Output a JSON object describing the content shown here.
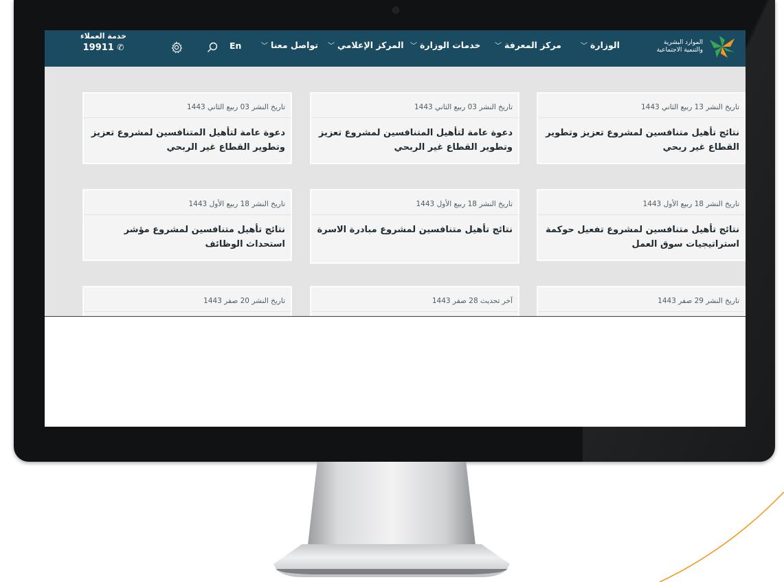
{
  "nav": {
    "logo_line1": "الموارد البشرية",
    "logo_line2": "والتنمية الاجتماعية",
    "items": [
      {
        "label": "الوزارة"
      },
      {
        "label": "مركز المعرفة"
      },
      {
        "label": "خدمات الوزارة"
      },
      {
        "label": "المركز الإعلامي"
      },
      {
        "label": "تواصل معنا"
      }
    ],
    "lang_label": "En",
    "customer_service_label": "خدمة العملاء",
    "customer_service_number": "19911"
  },
  "cards": [
    {
      "date": "تاريخ النشر 13 ربيع الثاني 1443",
      "title": "نتائج تأهيل متنافسين لمشروع تعزيز وتطوير القطاع غير ربحي"
    },
    {
      "date": "تاريخ النشر 03 ربيع الثاني 1443",
      "title": "دعوة عامة لتأهيل المتنافسين لمشروع تعزيز وتطوير القطاع غير الربحي"
    },
    {
      "date": "تاريخ النشر 03 ربيع الثاني 1443",
      "title": "دعوة عامة لتأهيل المتنافسين لمشروع تعزيز وتطوير القطاع غير الربحي"
    },
    {
      "date": "تاريخ النشر 18 ربيع الأول 1443",
      "title": "نتائج تأهيل متنافسين لمشروع تفعيل حوكمة استراتيجيات سوق العمل"
    },
    {
      "date": "تاريخ النشر 18 ربيع الأول 1443",
      "title": "نتائج تأهيل متنافسين لمشروع مبادرة الاسرة"
    },
    {
      "date": "تاريخ النشر 18 ربيع الأول 1443",
      "title": "نتائج تأهيل متنافسين لمشروع مؤشر استحداث الوظائف"
    },
    {
      "date": "تاريخ النشر 29 صفر 1443",
      "title": ""
    },
    {
      "date": "آخر تحديث 28 صفر 1443",
      "title": ""
    },
    {
      "date": "تاريخ النشر 20 صفر 1443",
      "title": ""
    }
  ],
  "colors": {
    "nav_bg": "#1b4b60",
    "logo_green": "#3aa655",
    "logo_orange": "#f39a1e",
    "decor_line": "#f39a1e"
  }
}
